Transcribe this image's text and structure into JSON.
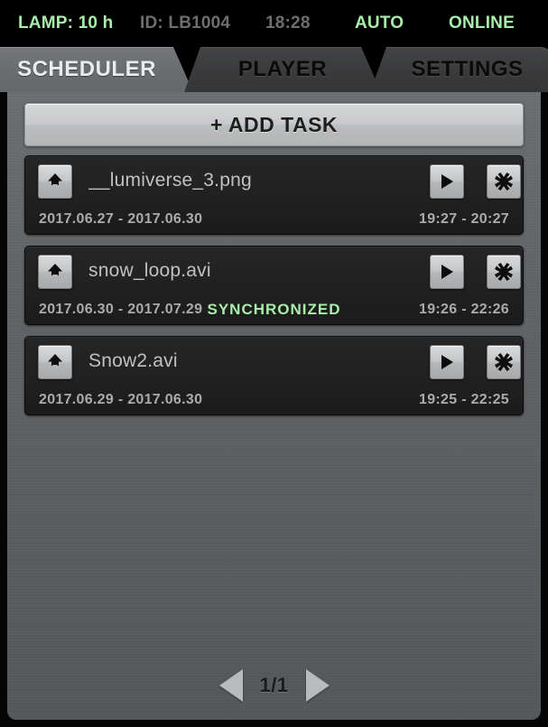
{
  "status_bar": {
    "lamp": "LAMP: 10 h",
    "device_id": "ID: LB1004",
    "clock": "18:28",
    "mode": "AUTO",
    "connection": "ONLINE",
    "accent_green": "#a8eda8",
    "muted_gray": "#6e6e6e"
  },
  "tabs": [
    {
      "label": "SCHEDULER",
      "active": true
    },
    {
      "label": "PLAYER",
      "active": false
    },
    {
      "label": "SETTINGS",
      "active": false
    }
  ],
  "toolbar": {
    "add_task_label": "+ ADD TASK"
  },
  "tasks": [
    {
      "filename": "__lumiverse_3.png",
      "dates": "2017.06.27 - 2017.06.30",
      "times": "19:27 - 20:27",
      "status": "",
      "up_icon": "arrow-up-icon",
      "play_icon": "play-icon",
      "close_icon": "close-x-icon"
    },
    {
      "filename": "snow_loop.avi",
      "dates": "2017.06.30 - 2017.07.29",
      "times": "19:26 - 22:26",
      "status": "SYNCHRONIZED",
      "up_icon": "arrow-up-icon",
      "play_icon": "play-icon",
      "close_icon": "close-x-icon"
    },
    {
      "filename": "Snow2.avi",
      "dates": "2017.06.29 - 2017.06.30",
      "times": "19:25 - 22:25",
      "status": "",
      "up_icon": "arrow-up-icon",
      "play_icon": "play-icon",
      "close_icon": "close-x-icon"
    }
  ],
  "pagination": {
    "page_label": "1/1",
    "prev_icon": "triangle-left-icon",
    "next_icon": "triangle-right-icon"
  }
}
